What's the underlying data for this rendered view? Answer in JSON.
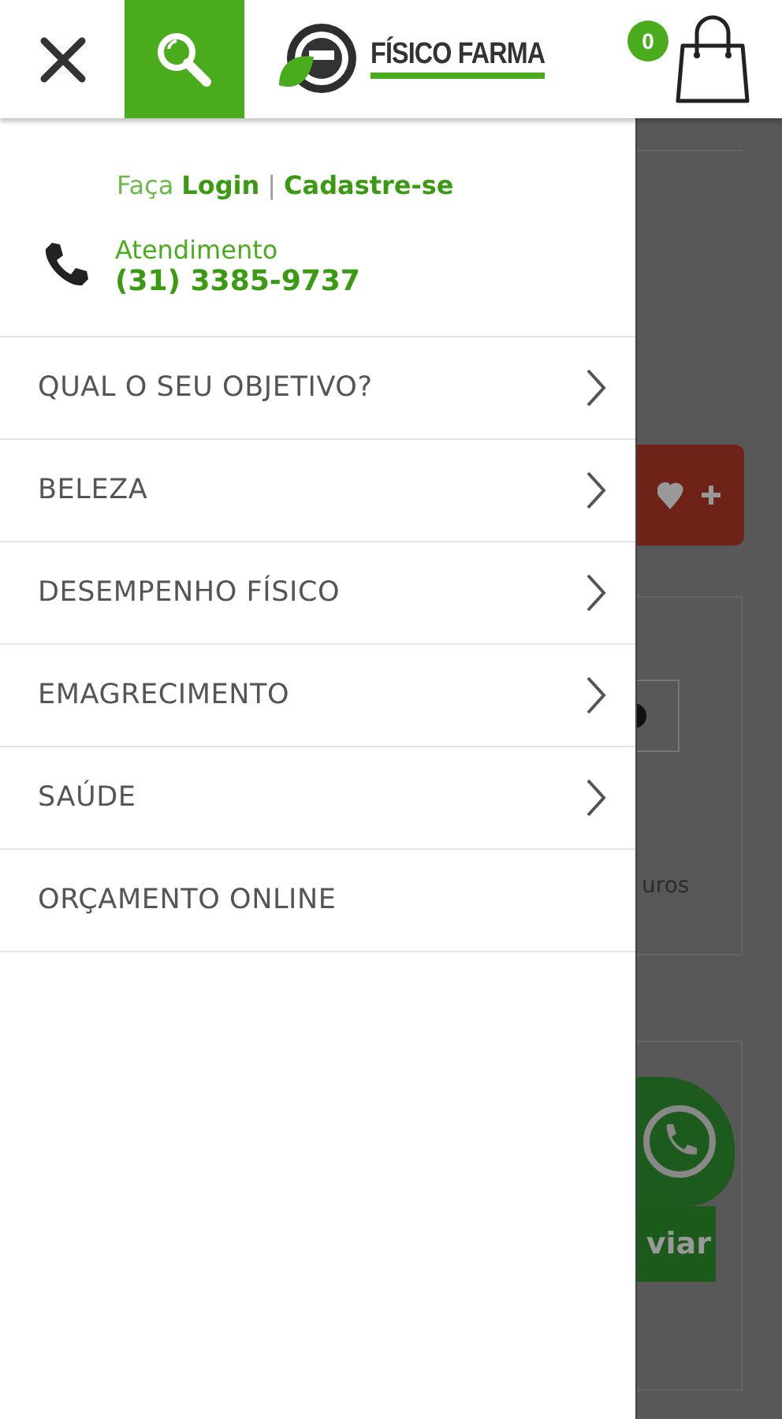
{
  "header": {
    "logo_text": "FÍSICO FARMA",
    "cart_count": "0"
  },
  "account": {
    "prefix": "Faça",
    "login": "Login",
    "separator": "|",
    "signup": "Cadastre-se"
  },
  "contact": {
    "label": "Atendimento",
    "phone": "(31) 3385-9737"
  },
  "menu": [
    {
      "label": "QUAL O SEU OBJETIVO?",
      "has_submenu": true
    },
    {
      "label": "BELEZA",
      "has_submenu": true
    },
    {
      "label": "DESEMPENHO FÍSICO",
      "has_submenu": true
    },
    {
      "label": "EMAGRECIMENTO",
      "has_submenu": true
    },
    {
      "label": "SAÚDE",
      "has_submenu": true
    },
    {
      "label": "ORÇAMENTO ONLINE",
      "has_submenu": false
    }
  ],
  "background": {
    "card_text": "uros",
    "button_text": "viar"
  }
}
